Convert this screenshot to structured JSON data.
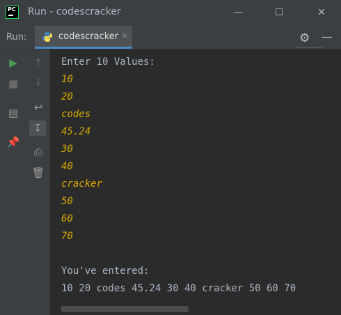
{
  "window": {
    "title": "Run - codescracker",
    "app_logo_text": "PC",
    "minimize_icon": "minimize-icon",
    "maximize_icon": "maximize-icon",
    "close_icon": "close-icon"
  },
  "run_panel": {
    "label": "Run:",
    "tab": {
      "label": "codescracker",
      "icon": "python-icon"
    },
    "gear_icon": "gear-icon",
    "hide_icon": "minus-icon"
  },
  "left_toolbar": [
    {
      "name": "run-icon",
      "color": "#499c54"
    },
    {
      "name": "stop-icon"
    },
    {
      "name": "layout-icon"
    },
    {
      "name": "pin-icon"
    }
  ],
  "console_toolbar": [
    {
      "name": "up-arrow-icon"
    },
    {
      "name": "down-arrow-icon"
    },
    {
      "name": "soft-wrap-icon"
    },
    {
      "name": "scroll-to-end-icon"
    },
    {
      "name": "print-icon"
    },
    {
      "name": "trash-icon"
    }
  ],
  "console": {
    "lines": [
      {
        "text": "Enter 10 Values:",
        "kind": "out"
      },
      {
        "text": "10",
        "kind": "inp"
      },
      {
        "text": "20",
        "kind": "inp"
      },
      {
        "text": "codes",
        "kind": "inp"
      },
      {
        "text": "45.24",
        "kind": "inp"
      },
      {
        "text": "30",
        "kind": "inp"
      },
      {
        "text": "40",
        "kind": "inp"
      },
      {
        "text": "cracker",
        "kind": "inp"
      },
      {
        "text": "50",
        "kind": "inp"
      },
      {
        "text": "60",
        "kind": "inp"
      },
      {
        "text": "70",
        "kind": "inp"
      },
      {
        "text": "",
        "kind": "out"
      },
      {
        "text": "You've entered:",
        "kind": "out"
      },
      {
        "text": "10 20 codes 45.24 30 40 cracker 50 60 70",
        "kind": "out"
      }
    ]
  },
  "colors": {
    "output": "#a9b7c6",
    "input": "#d6a900",
    "background": "#2b2b2b",
    "accent": "#4a88c7"
  }
}
